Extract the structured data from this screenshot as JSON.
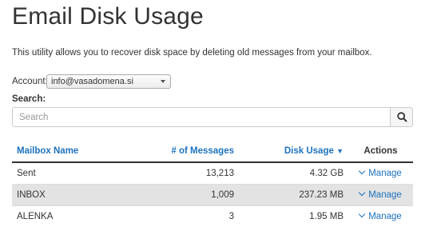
{
  "page": {
    "title": "Email Disk Usage",
    "description": "This utility allows you to recover disk space by deleting old messages from your mailbox."
  },
  "account": {
    "label": "Account:",
    "selected": "info@vasadomena.si"
  },
  "search": {
    "label": "Search:",
    "placeholder": "Search",
    "value": ""
  },
  "table": {
    "columns": {
      "mailbox": "Mailbox Name",
      "messages": "# of Messages",
      "usage": "Disk Usage",
      "usage_sort": "▼",
      "actions": "Actions"
    },
    "rows": [
      {
        "name": "Sent",
        "messages": "13,213",
        "usage": "4.32 GB",
        "action": "Manage"
      },
      {
        "name": "INBOX",
        "messages": "1,009",
        "usage": "237.23 MB",
        "action": "Manage"
      },
      {
        "name": "ALENKA",
        "messages": "3",
        "usage": "1.95 MB",
        "action": "Manage"
      }
    ]
  },
  "colors": {
    "link": "#1e73be",
    "stripe": "#e3e3e3"
  }
}
